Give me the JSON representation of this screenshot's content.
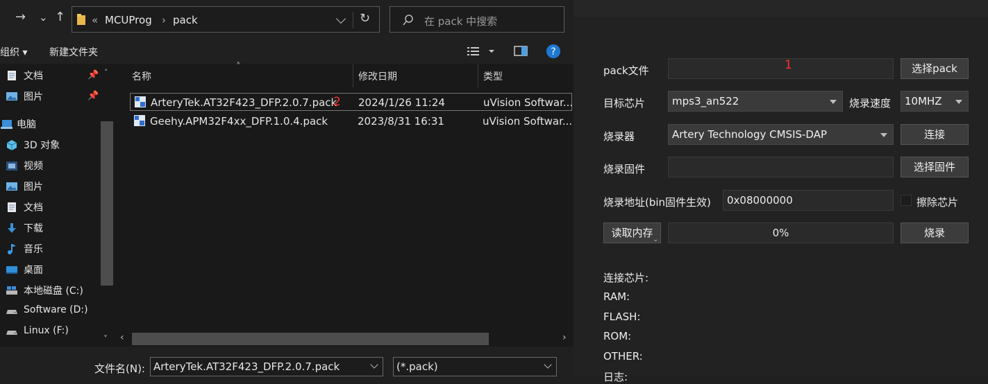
{
  "dialog": {
    "nav": {
      "forward": "→",
      "dropdown": "⌄",
      "up": "↑",
      "refresh": "↻"
    },
    "address": {
      "overflow": "«",
      "crumbs": [
        "MCUProg",
        "pack"
      ],
      "sep": "›"
    },
    "search": {
      "placeholder": "在 pack 中搜索"
    },
    "cmdbar": {
      "organize": "组织",
      "new_folder": "新建文件夹"
    },
    "sidebar": [
      {
        "label": "文档",
        "icon": "document-icon",
        "pinned": true
      },
      {
        "label": "图片",
        "icon": "pictures-icon",
        "pinned": true
      },
      {
        "label": "电脑",
        "icon": "computer-icon",
        "pinned": false
      },
      {
        "label": "3D 对象",
        "icon": "3d-objects-icon",
        "pinned": false
      },
      {
        "label": "视频",
        "icon": "videos-icon",
        "pinned": false
      },
      {
        "label": "图片",
        "icon": "pictures-icon",
        "pinned": false
      },
      {
        "label": "文档",
        "icon": "document-icon",
        "pinned": false
      },
      {
        "label": "下载",
        "icon": "download-icon",
        "pinned": false
      },
      {
        "label": "音乐",
        "icon": "music-icon",
        "pinned": false
      },
      {
        "label": "桌面",
        "icon": "desktop-icon",
        "pinned": false
      },
      {
        "label": "本地磁盘 (C:)",
        "icon": "drive-icon",
        "pinned": false
      },
      {
        "label": "Software (D:)",
        "icon": "drive-icon",
        "pinned": false
      },
      {
        "label": "Linux (F:)",
        "icon": "drive-icon",
        "pinned": false
      }
    ],
    "columns": {
      "name": "名称",
      "modified": "修改日期",
      "type": "类型"
    },
    "files": [
      {
        "name": "ArteryTek.AT32F423_DFP.2.0.7.pack",
        "modified": "2024/1/26 11:24",
        "type": "uVision Softwar...",
        "selected": true
      },
      {
        "name": "Geehy.APM32F4xx_DFP.1.0.4.pack",
        "modified": "2023/8/31 16:31",
        "type": "uVision Softwar...",
        "selected": false
      }
    ],
    "filename_label": "文件名(N):",
    "filename_value": "ArteryTek.AT32F423_DFP.2.0.7.pack",
    "filter_value": "(*.pack)"
  },
  "app": {
    "pack_label": "pack文件",
    "pack_value": "",
    "select_pack": "选择pack",
    "chip_label": "目标芯片",
    "chip_value": "mps3_an522",
    "speed_label": "烧录速度",
    "speed_value": "10MHZ",
    "probe_label": "烧录器",
    "probe_value": "Artery Technology CMSIS-DAP",
    "connect": "连接",
    "firmware_label": "烧录固件",
    "firmware_value": "",
    "select_firmware": "选择固件",
    "address_label": "烧录地址(bin固件生效)",
    "address_value": "0x08000000",
    "erase_label": "擦除芯片",
    "erase_checked": false,
    "read_memory": "读取内存",
    "progress_text": "0%",
    "progress": 0,
    "burn": "烧录",
    "info": {
      "connected": "连接芯片:",
      "ram": "RAM:",
      "flash": "FLASH:",
      "rom": "ROM:",
      "other": "OTHER:",
      "log": "日志:"
    }
  },
  "annotations": {
    "first": "1",
    "second": "2"
  },
  "colors": {
    "accent": "#0a84ff",
    "annotation": "#ff3030"
  }
}
